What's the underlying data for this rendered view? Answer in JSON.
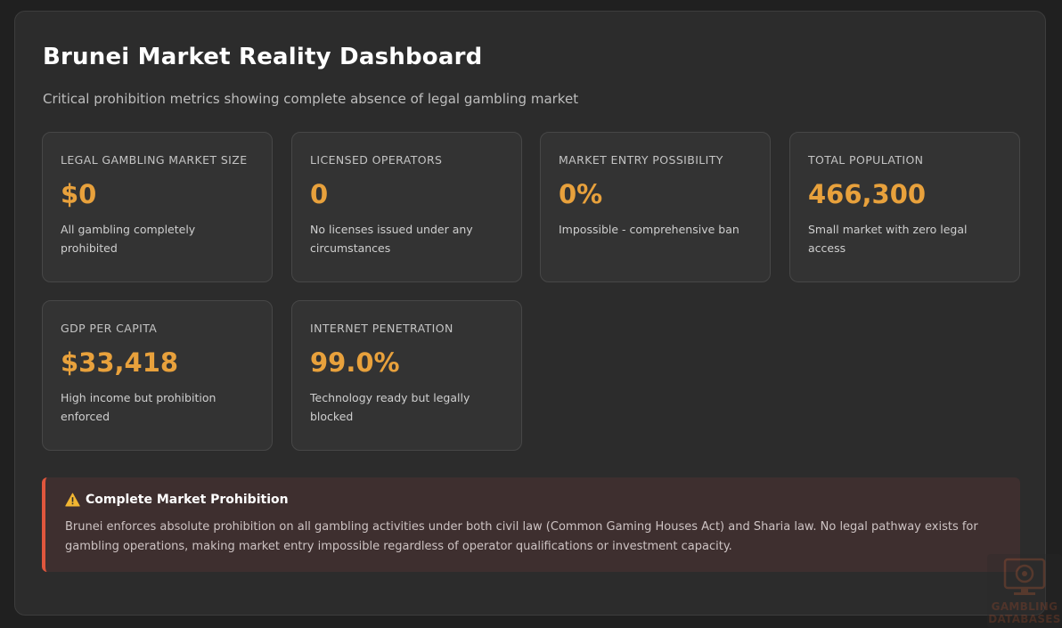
{
  "header": {
    "title": "Brunei Market Reality Dashboard",
    "subtitle": "Critical prohibition metrics showing complete absence of legal gambling market"
  },
  "metrics": [
    {
      "label": "LEGAL GAMBLING MARKET SIZE",
      "value": "$0",
      "description": "All gambling completely prohibited"
    },
    {
      "label": "LICENSED OPERATORS",
      "value": "0",
      "description": "No licenses issued under any circumstances"
    },
    {
      "label": "MARKET ENTRY POSSIBILITY",
      "value": "0%",
      "description": "Impossible - comprehensive ban"
    },
    {
      "label": "TOTAL POPULATION",
      "value": "466,300",
      "description": "Small market with zero legal access"
    },
    {
      "label": "GDP PER CAPITA",
      "value": "$33,418",
      "description": "High income but prohibition enforced"
    },
    {
      "label": "INTERNET PENETRATION",
      "value": "99.0%",
      "description": "Technology ready but legally blocked"
    }
  ],
  "alert": {
    "icon": "warning-icon",
    "title": "Complete Market Prohibition",
    "body": "Brunei enforces absolute prohibition on all gambling activities under both civil law (Common Gaming Houses Act) and Sharia law. No legal pathway exists for gambling operations, making market entry impossible regardless of operator qualifications or investment capacity."
  },
  "watermark": {
    "line1": "GAMBLING",
    "line2": "DATABASES"
  },
  "colors": {
    "accent_value": "#e8a13c",
    "alert_border": "#e0563d",
    "alert_background": "#3e2f2f"
  }
}
